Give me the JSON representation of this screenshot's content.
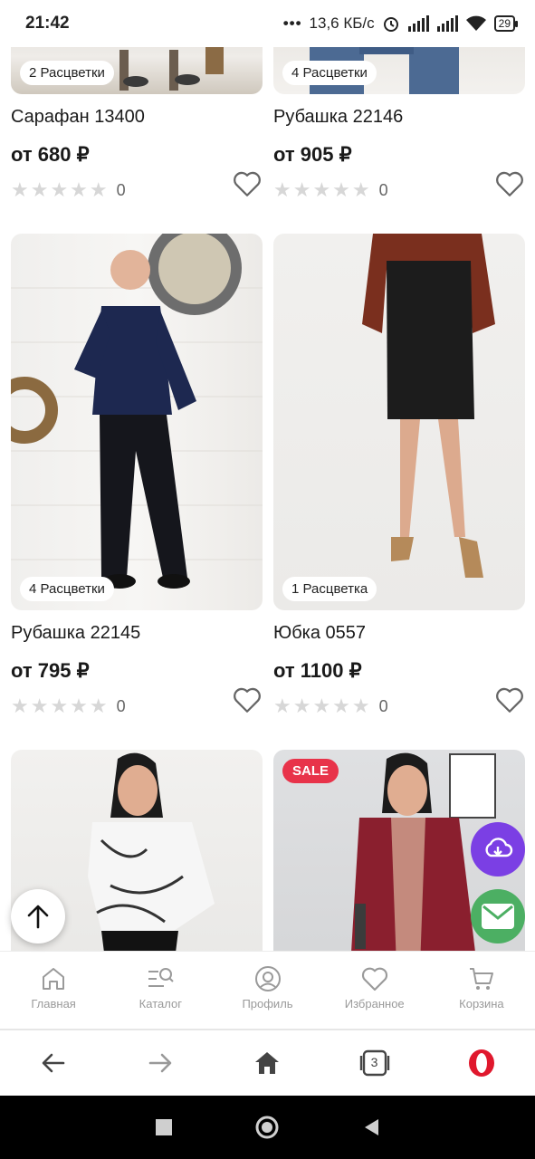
{
  "status": {
    "time": "21:42",
    "speed": "13,6 КБ/с",
    "battery": "29"
  },
  "products": [
    {
      "name": "Сарафан 13400",
      "price": "от 680 ₽",
      "colors": "2 Расцветки",
      "rating_count": "0"
    },
    {
      "name": "Рубашка 22146",
      "price": "от 905 ₽",
      "colors": "4 Расцветки",
      "rating_count": "0"
    },
    {
      "name": "Рубашка 22145",
      "price": "от 795 ₽",
      "colors": "4 Расцветки",
      "rating_count": "0"
    },
    {
      "name": "Юбка 0557",
      "price": "от 1100 ₽",
      "colors": "1 Расцветка",
      "rating_count": "0"
    },
    {
      "sale": "SALE"
    }
  ],
  "tabs": [
    {
      "label": "Главная",
      "icon": "home-icon"
    },
    {
      "label": "Каталог",
      "icon": "catalog-search-icon"
    },
    {
      "label": "Профиль",
      "icon": "profile-icon"
    },
    {
      "label": "Избранное",
      "icon": "heart-icon"
    },
    {
      "label": "Корзина",
      "icon": "cart-icon"
    }
  ],
  "browser": {
    "tab_count": "3"
  },
  "colors": {
    "sale_badge": "#e8334a",
    "cloud_fab": "#7b3fe4",
    "mail_fab": "#4caf63",
    "tab_inactive": "#9a9a9a",
    "opera_red": "#e0182d"
  }
}
